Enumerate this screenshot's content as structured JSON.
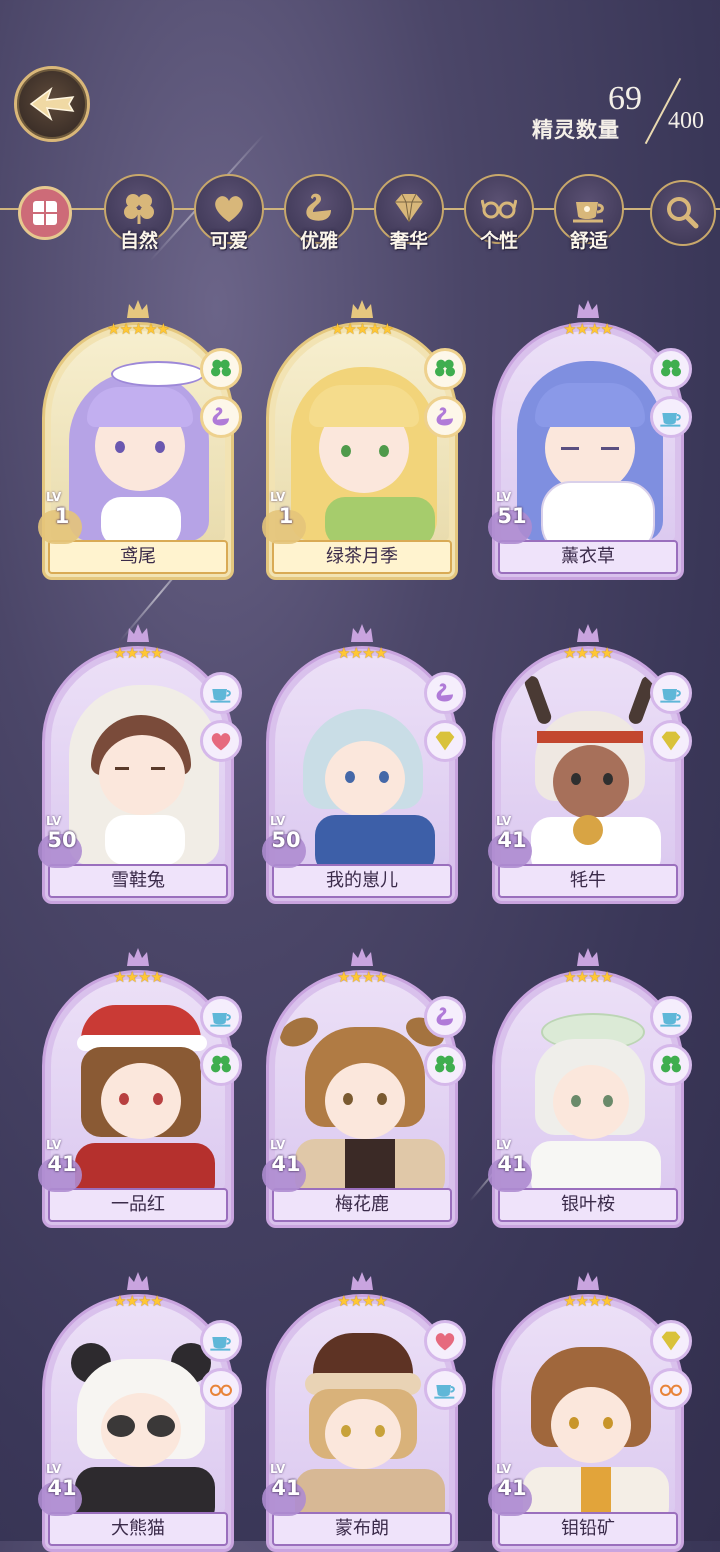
{
  "header": {
    "back_icon": "back-arrow-icon",
    "count_current": "69",
    "count_max": "400",
    "count_label": "精灵数量"
  },
  "filters": [
    {
      "label": "自然",
      "icon": "clover-icon"
    },
    {
      "label": "可爱",
      "icon": "heart-icon"
    },
    {
      "label": "优雅",
      "icon": "swan-icon"
    },
    {
      "label": "奢华",
      "icon": "diamond-icon"
    },
    {
      "label": "个性",
      "icon": "glasses-icon"
    },
    {
      "label": "舒适",
      "icon": "teacup-icon"
    }
  ],
  "colors": {
    "accent_gold": "#d9b779",
    "card_purple": "#d9c1ec",
    "card_gold": "#f2e3b3",
    "star": "#ffc734"
  },
  "cards": [
    {
      "name": "鸢尾",
      "level": "1",
      "level_label": "LV",
      "stars": "★★★★★",
      "tags": [
        "clover-icon",
        "swan-icon"
      ],
      "frame": "gold"
    },
    {
      "name": "绿茶月季",
      "level": "1",
      "level_label": "LV",
      "stars": "★★★★★",
      "tags": [
        "clover-icon",
        "swan-icon"
      ],
      "frame": "gold"
    },
    {
      "name": "薰衣草",
      "level": "51",
      "level_label": "LV",
      "stars": "★★★★",
      "tags": [
        "clover-icon",
        "teacup-icon"
      ],
      "frame": "purple"
    },
    {
      "name": "雪鞋兔",
      "level": "50",
      "level_label": "LV",
      "stars": "★★★★",
      "tags": [
        "teacup-icon",
        "heart-icon"
      ],
      "frame": "purple"
    },
    {
      "name": "我的崽儿",
      "level": "50",
      "level_label": "LV",
      "stars": "★★★★",
      "tags": [
        "swan-icon",
        "diamond-icon"
      ],
      "frame": "purple"
    },
    {
      "name": "牦牛",
      "level": "41",
      "level_label": "LV",
      "stars": "★★★★",
      "tags": [
        "teacup-icon",
        "diamond-icon"
      ],
      "frame": "purple"
    },
    {
      "name": "一品红",
      "level": "41",
      "level_label": "LV",
      "stars": "★★★★",
      "tags": [
        "teacup-icon",
        "clover-icon"
      ],
      "frame": "purple"
    },
    {
      "name": "梅花鹿",
      "level": "41",
      "level_label": "LV",
      "stars": "★★★★",
      "tags": [
        "swan-icon",
        "clover-icon"
      ],
      "frame": "purple"
    },
    {
      "name": "银叶桉",
      "level": "41",
      "level_label": "LV",
      "stars": "★★★★",
      "tags": [
        "teacup-icon",
        "clover-icon"
      ],
      "frame": "purple"
    },
    {
      "name": "大熊猫",
      "level": "41",
      "level_label": "LV",
      "stars": "★★★★",
      "tags": [
        "teacup-icon",
        "glasses-icon"
      ],
      "frame": "purple"
    },
    {
      "name": "蒙布朗",
      "level": "41",
      "level_label": "LV",
      "stars": "★★★★",
      "tags": [
        "heart-icon",
        "teacup-icon"
      ],
      "frame": "purple"
    },
    {
      "name": "钼铅矿",
      "level": "41",
      "level_label": "LV",
      "stars": "★★★★",
      "tags": [
        "diamond-icon",
        "glasses-icon"
      ],
      "frame": "purple"
    }
  ]
}
